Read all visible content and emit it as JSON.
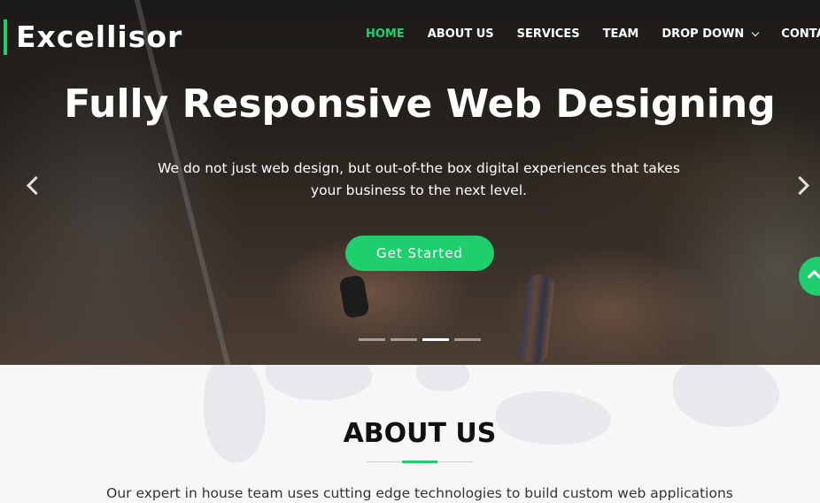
{
  "header": {
    "logo": "Excellisor",
    "nav": [
      {
        "label": "HOME",
        "active": true
      },
      {
        "label": "ABOUT US"
      },
      {
        "label": "SERVICES"
      },
      {
        "label": "TEAM"
      },
      {
        "label": "DROP DOWN",
        "has_dropdown": true
      },
      {
        "label": "CONTACT"
      }
    ]
  },
  "hero": {
    "title": "Fully Responsive Web Designing",
    "subtitle": "We do not just web design, but out-of-the box digital experiences that takes your business to the next level.",
    "cta_label": "Get Started",
    "slide_count": 4,
    "active_slide": 3
  },
  "about": {
    "title": "ABOUT US",
    "text": "Our expert in house team uses cutting edge technologies to build custom web applications"
  },
  "colors": {
    "accent": "#1fce6d",
    "text_dark": "#111111",
    "hero_overlay": "#2a2724"
  },
  "icons": {
    "prev": "chevron-left-icon",
    "next": "chevron-right-icon",
    "scroll_top": "chevron-up-icon",
    "dropdown": "chevron-down-icon"
  }
}
